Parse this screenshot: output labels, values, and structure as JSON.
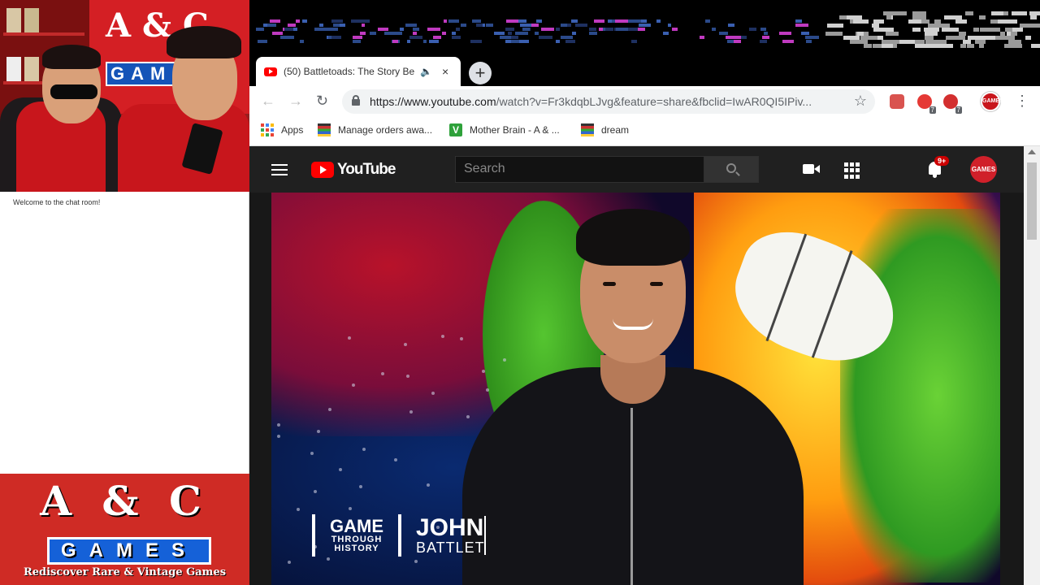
{
  "webcam": {
    "sign_text": "A & C",
    "sign_band": "GAM"
  },
  "chat": {
    "welcome": "Welcome to the chat room!"
  },
  "logo": {
    "ac": "A & C",
    "games": "GAMES",
    "tagline": "Rediscover Rare & Vintage Games"
  },
  "browser": {
    "tab": {
      "title": "(50) Battletoads: The Story Be",
      "audio_icon": "speaker-icon",
      "close": "×"
    },
    "new_tab": "+",
    "url_host": "https://www.youtube.com",
    "url_path": "/watch?v=Fr3kdqbLJvg&feature=share&fbclid=IwAR0QI5IPiv...",
    "extension_badges": [
      "7",
      "7"
    ],
    "profile_label": "GAMES",
    "bookmarks": [
      {
        "label": "Apps",
        "icon": "apps-grid-icon"
      },
      {
        "label": "Manage orders awa...",
        "icon": "shop-icon"
      },
      {
        "label": "Mother Brain - A & ...",
        "icon": "v-icon"
      },
      {
        "label": "dream",
        "icon": "shop-icon"
      }
    ]
  },
  "youtube": {
    "logo_text": "YouTube",
    "search_placeholder": "Search",
    "notifications_badge": "9+",
    "avatar_label": "GAMES",
    "video": {
      "show_line1": "GAME",
      "show_line2": "THROUGH",
      "show_line3": "HISTORY",
      "name_line1": "JOHN",
      "name_line2": "BATTLET"
    }
  },
  "colors": {
    "youtube_red": "#ff0000",
    "brand_red": "#cf2b25",
    "brand_blue": "#1561d8",
    "yt_dark": "#202020"
  }
}
